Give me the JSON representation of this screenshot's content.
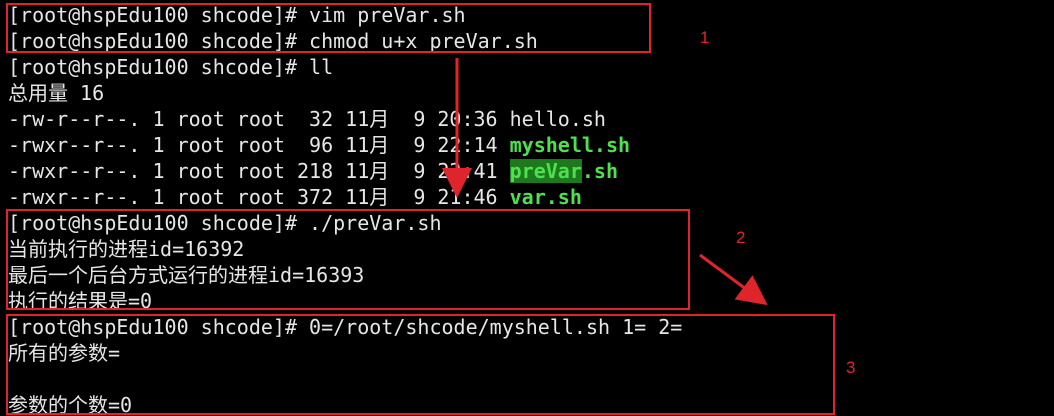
{
  "terminal": {
    "prompt": "[root@hspEdu100 shcode]# ",
    "commands": {
      "c1": "vim preVar.sh",
      "c2": "chmod u+x preVar.sh",
      "c3": "ll",
      "c4": "./preVar.sh",
      "c5": "0=/root/shcode/myshell.sh 1= 2="
    },
    "total_line": "总用量 16",
    "listing": [
      {
        "meta": "-rw-r--r--. 1 root root  32 11月  9 20:36 ",
        "name": "hello.sh"
      },
      {
        "meta": "-rwxr--r--. 1 root root  96 11月  9 22:14 ",
        "name": "myshell.sh"
      },
      {
        "meta": "-rwxr--r--. 1 root root 218 11月  9 22:41 ",
        "name_hl": "preVar",
        "name_ext": ".sh"
      },
      {
        "meta": "-rwxr--r--. 1 root root 372 11月  9 21:46 ",
        "name": "var.sh"
      }
    ],
    "output1": [
      "当前执行的进程id=16392",
      "最后一个后台方式运行的进程id=16393",
      "执行的结果是=0"
    ],
    "output2": [
      "所有的参数=",
      "",
      "参数的个数=0"
    ]
  },
  "annotations": {
    "box1_label": "1",
    "box2_label": "2",
    "box3_label": "3",
    "color": "#e0242c"
  }
}
